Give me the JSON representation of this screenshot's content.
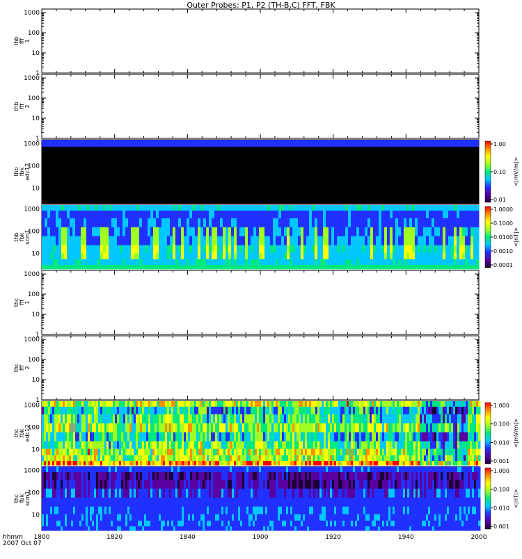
{
  "chart_data": {
    "title": "Outer Probes: P1, P2 (TH-B,C) FFT, FBK",
    "type": "heatmap",
    "x_ticks": [
      "1800",
      "1820",
      "1840",
      "1900",
      "1920",
      "1940",
      "2000"
    ],
    "x_axis_label": "hhmm",
    "date_label": "2007 Oct 07",
    "panels": [
      {
        "ylabel": [
          "thb",
          "fff",
          "1"
        ],
        "y_ticks": [
          "1000",
          "100",
          "10",
          "1"
        ],
        "y_scale": "log",
        "content": "empty",
        "colorbar": null
      },
      {
        "ylabel": [
          "thb",
          "fff",
          "2"
        ],
        "y_ticks": [
          "1000",
          "100",
          "10",
          "1"
        ],
        "y_scale": "log",
        "content": "empty",
        "colorbar": null
      },
      {
        "ylabel": [
          "thb",
          "fbk",
          "edc12"
        ],
        "y_ticks": [
          "1000",
          "100",
          "10"
        ],
        "y_scale": "log",
        "content": "black_with_top_band",
        "colorbar": {
          "label": "<|mV/m|>",
          "ticks": [
            "1.00",
            "0.10",
            "0.01"
          ]
        }
      },
      {
        "ylabel": [
          "thb",
          "fbk",
          "scm1"
        ],
        "y_ticks": [
          "1000",
          "100",
          "10"
        ],
        "y_scale": "log",
        "content": "spectrogram_thb_scm1",
        "colorbar": {
          "label": "<|nT|>",
          "ticks": [
            "1.0000",
            "0.1000",
            "0.0100",
            "0.0010",
            "0.0001"
          ]
        }
      },
      {
        "ylabel": [
          "thc",
          "fff",
          "1"
        ],
        "y_ticks": [
          "1000",
          "100",
          "10",
          "1"
        ],
        "y_scale": "log",
        "content": "empty",
        "colorbar": null
      },
      {
        "ylabel": [
          "thc",
          "fff",
          "2"
        ],
        "y_ticks": [
          "1000",
          "100",
          "10",
          "1"
        ],
        "y_scale": "log",
        "content": "empty",
        "colorbar": null
      },
      {
        "ylabel": [
          "thc",
          "fbk",
          "edc12"
        ],
        "y_ticks": [
          "1000",
          "100",
          "10"
        ],
        "y_scale": "log",
        "content": "spectrogram_thc_edc12",
        "colorbar": {
          "label": "<|mV/m|>",
          "ticks": [
            "1.000",
            "0.100",
            "0.010",
            "0.001"
          ]
        }
      },
      {
        "ylabel": [
          "thc",
          "fbk",
          "scm1"
        ],
        "y_ticks": [
          "1000",
          "100",
          "10"
        ],
        "y_scale": "log",
        "content": "spectrogram_thc_scm1",
        "colorbar": {
          "label": "<|nT|>",
          "ticks": [
            "1.000",
            "0.100",
            "0.010",
            "0.001"
          ]
        }
      }
    ],
    "colors": {
      "colormap": [
        "#1a0033",
        "#5a00a0",
        "#2030ff",
        "#00c8ff",
        "#00e880",
        "#a0ff20",
        "#ffff00",
        "#ff9000",
        "#ff0000"
      ],
      "background": "#ffffff",
      "frame": "#000000"
    }
  }
}
